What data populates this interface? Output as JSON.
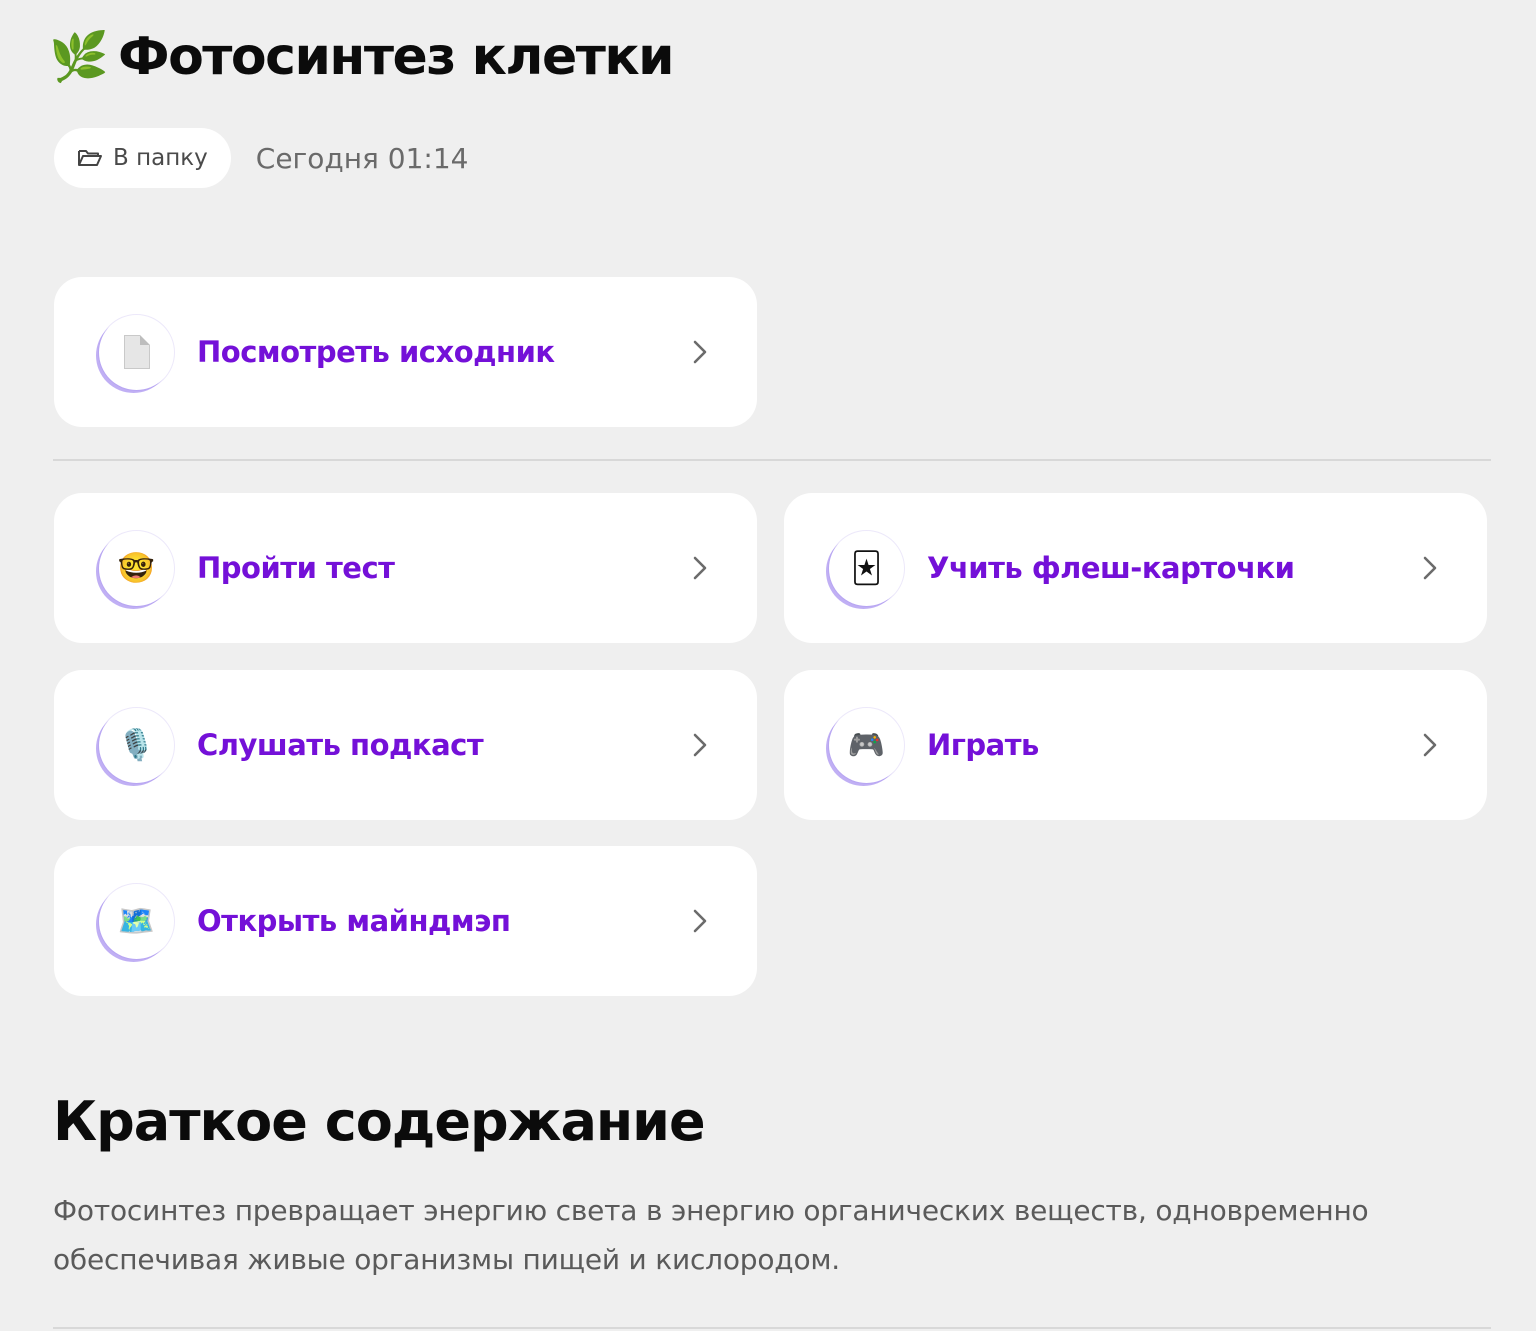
{
  "header": {
    "title_emoji": "🌿",
    "title": "Фотосинтез клетки",
    "folder_button_label": "В папку",
    "date": "Сегодня 01:14"
  },
  "actions": {
    "source": {
      "label": "Посмотреть исходник",
      "icon": "document-icon",
      "emoji": ""
    },
    "test": {
      "label": "Пройти тест",
      "icon": "nerd-face-icon",
      "emoji": "🤓"
    },
    "flashcards": {
      "label": "Учить флеш-карточки",
      "icon": "joker-card-icon",
      "emoji": "🃏"
    },
    "podcast": {
      "label": "Слушать подкаст",
      "icon": "microphone-icon",
      "emoji": "🎙️"
    },
    "game": {
      "label": "Играть",
      "icon": "gamepad-icon",
      "emoji": "🎮"
    },
    "mindmap": {
      "label": "Открыть майндмэп",
      "icon": "map-icon",
      "emoji": "🗺️"
    }
  },
  "summary": {
    "title": "Краткое содержание",
    "text": "Фотосинтез превращает энергию света в энергию органических веществ, одновременно обеспечивая живые организмы пищей и кислородом."
  },
  "colors": {
    "background": "#efefef",
    "card": "#ffffff",
    "accent": "#7410d8",
    "ring": "#8c6eeb"
  }
}
